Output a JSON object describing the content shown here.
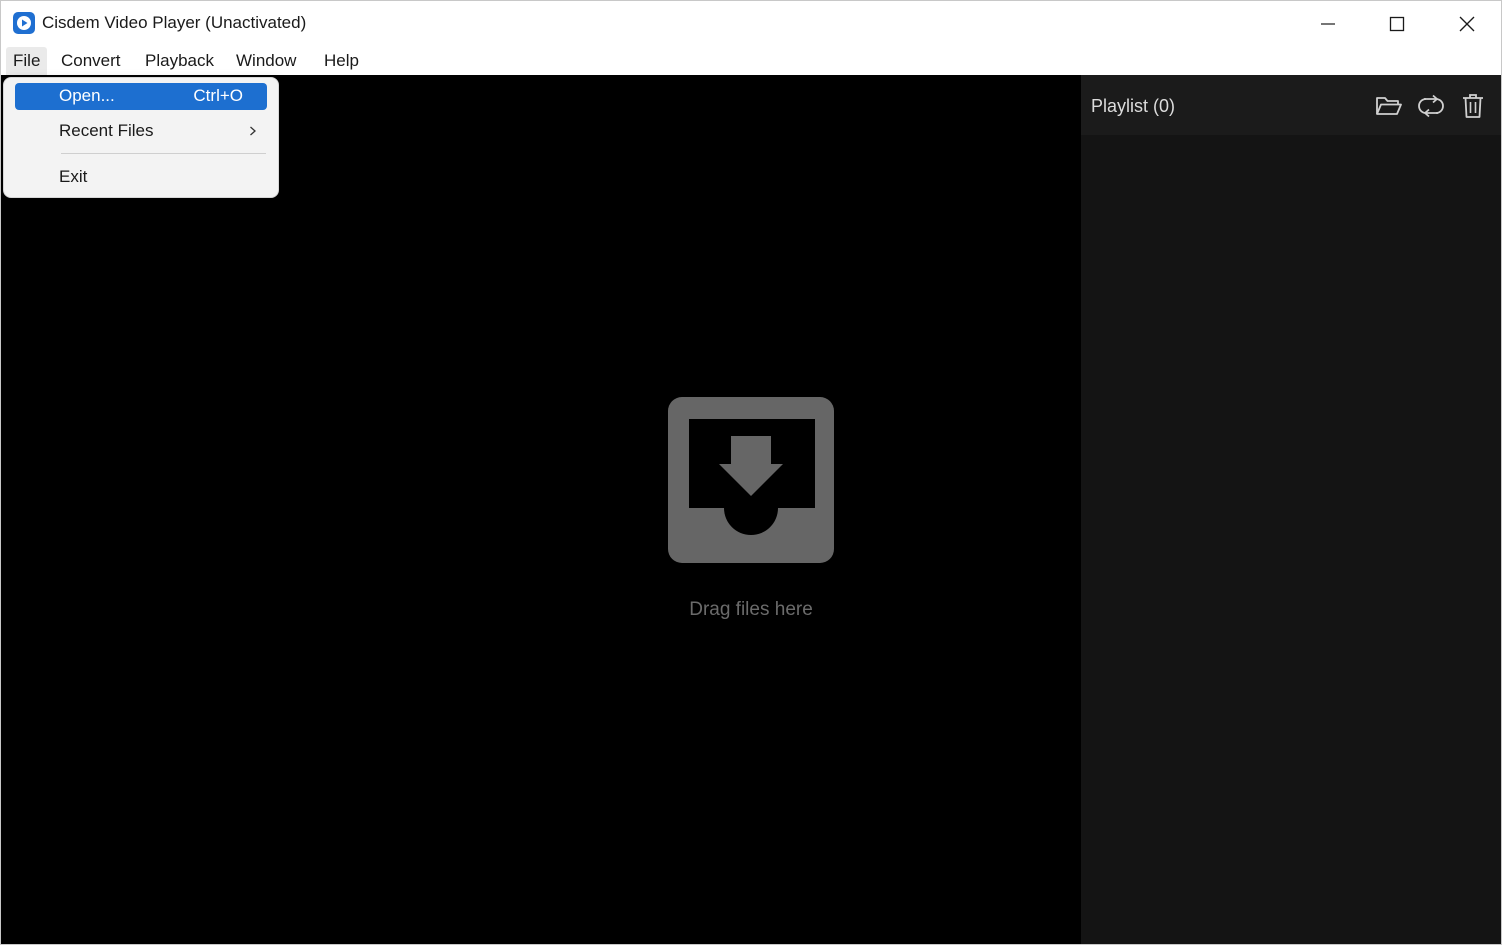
{
  "window": {
    "title": "Cisdem Video Player (Unactivated)",
    "accent": "#1d6fd0"
  },
  "menubar": {
    "items": [
      {
        "label": "File"
      },
      {
        "label": "Convert"
      },
      {
        "label": "Playback"
      },
      {
        "label": "Window"
      },
      {
        "label": "Help"
      }
    ],
    "active": "File"
  },
  "file_menu": {
    "open": {
      "label": "Open...",
      "shortcut": "Ctrl+O"
    },
    "recent": {
      "label": "Recent Files",
      "arrow": ">"
    },
    "exit": {
      "label": "Exit"
    }
  },
  "main": {
    "drop_text": "Drag files here",
    "icon": "download-tray-icon"
  },
  "playlist": {
    "title": "Playlist (0)",
    "buttons": [
      "folder-open-icon",
      "refresh-icon",
      "trash-icon"
    ]
  }
}
